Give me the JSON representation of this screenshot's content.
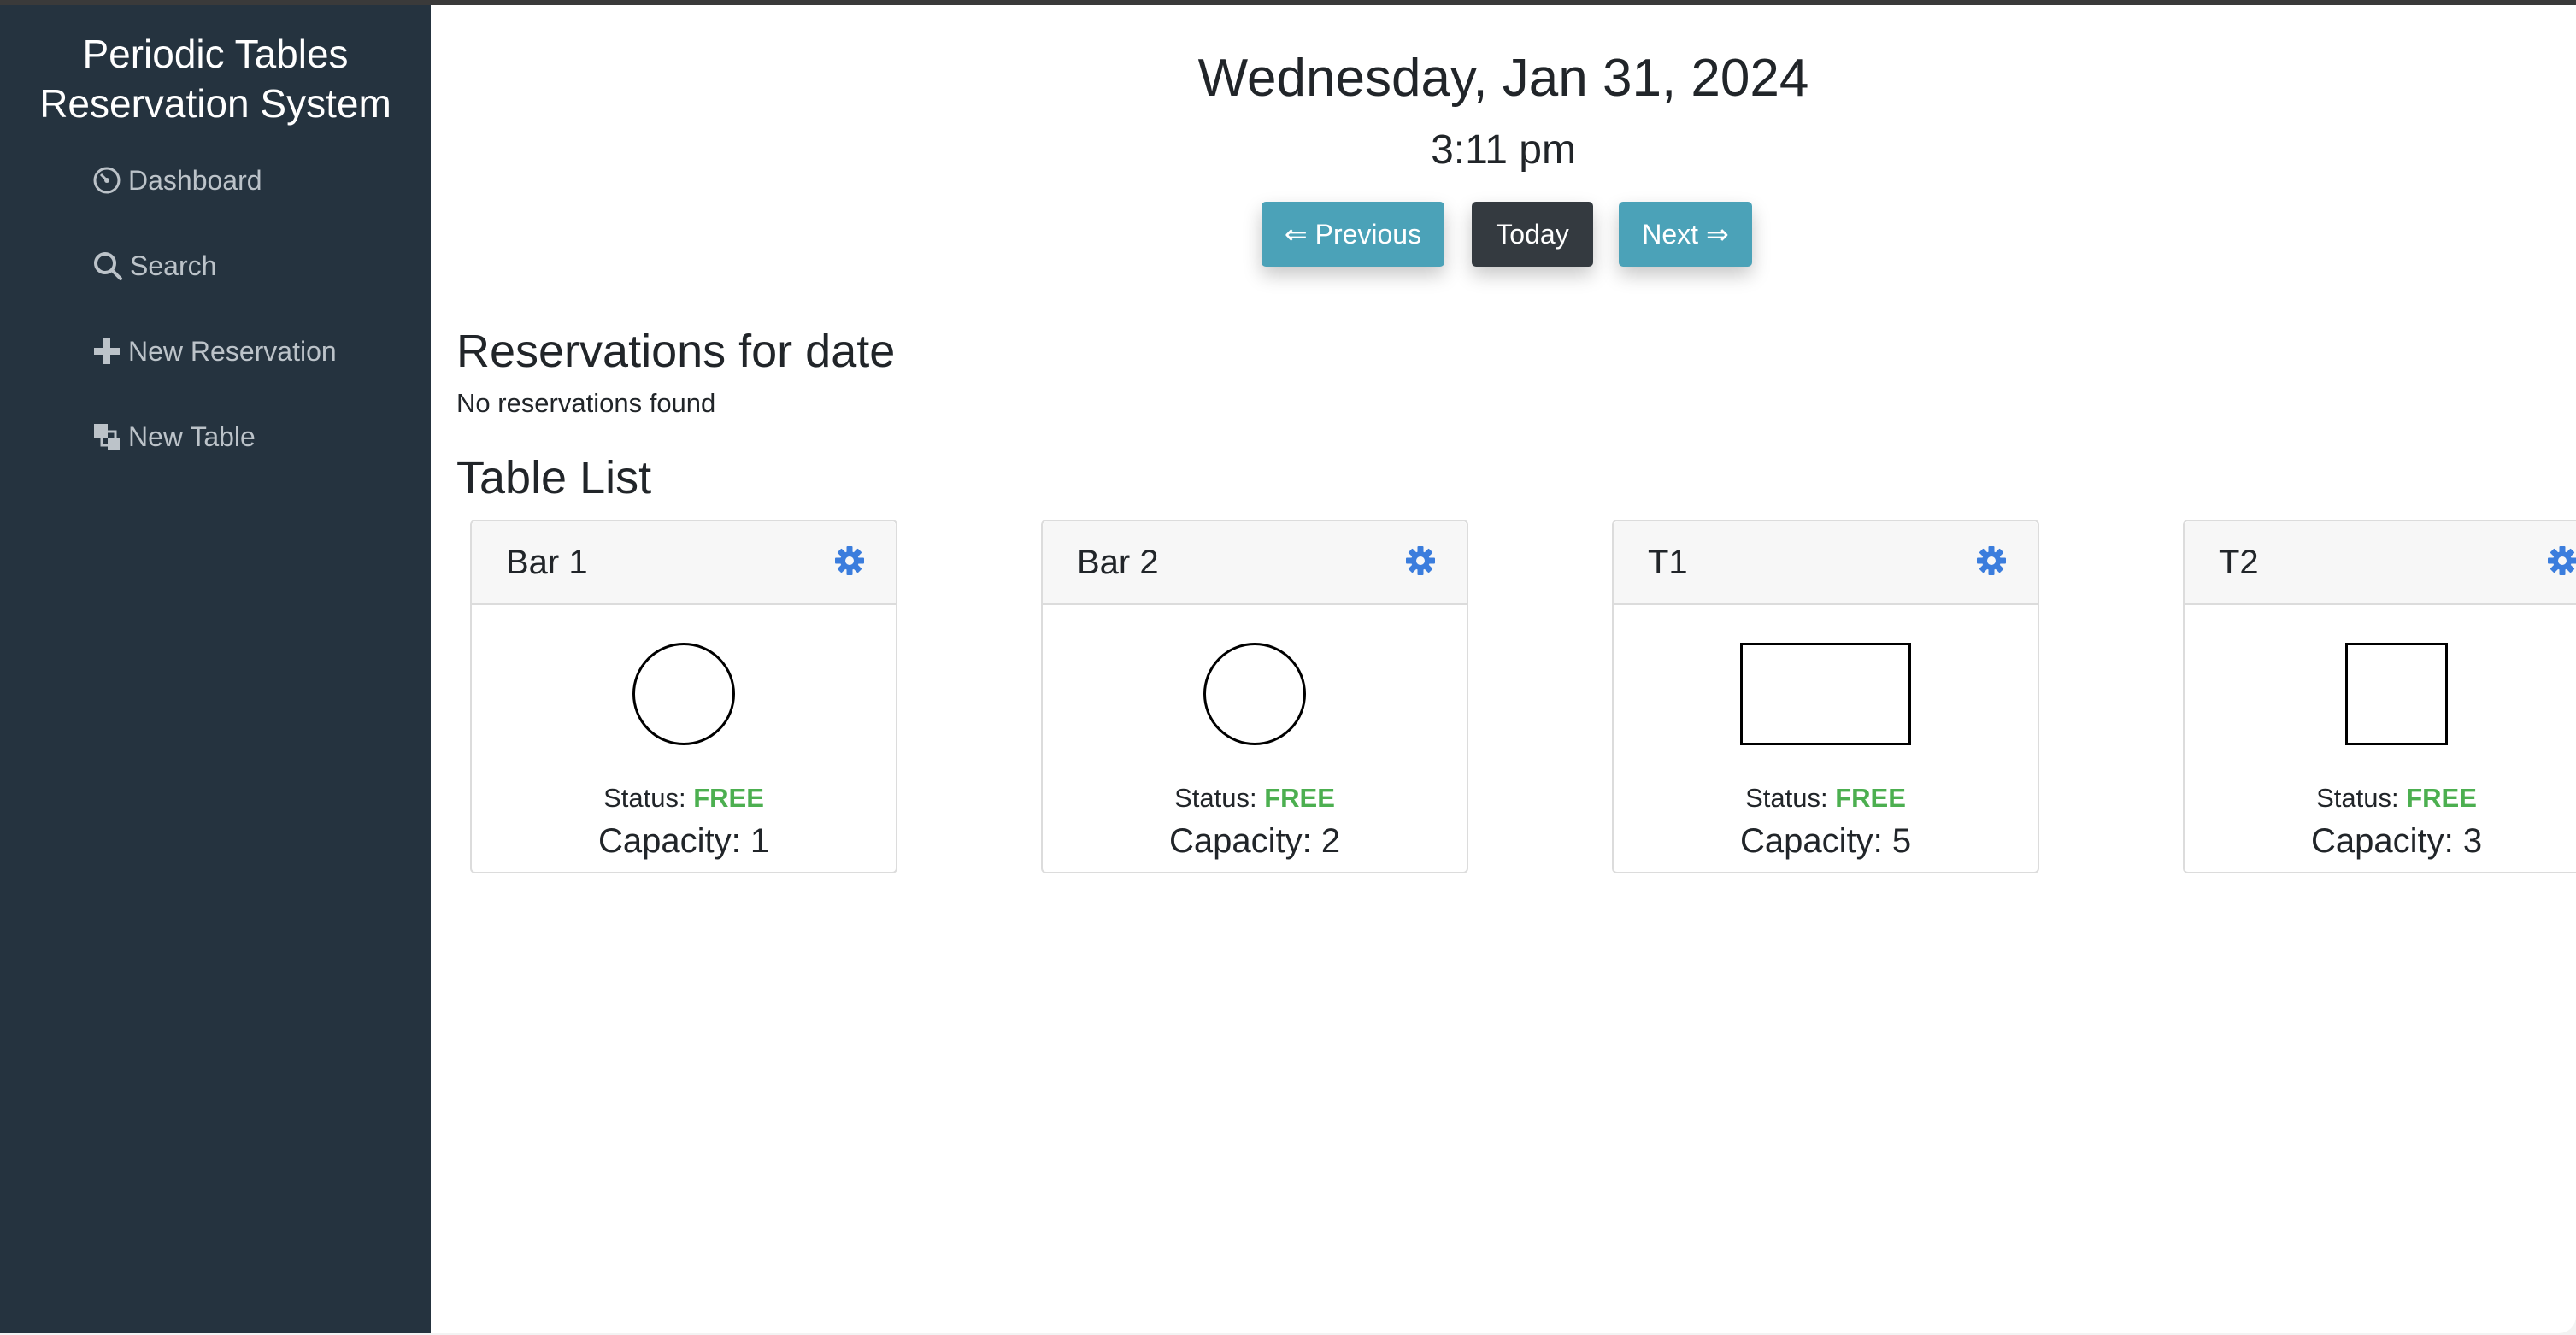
{
  "sidebar": {
    "brand_line1": "Periodic Tables",
    "brand_line2": "Reservation System",
    "items": [
      {
        "label": "Dashboard",
        "icon": "dashboard-icon"
      },
      {
        "label": "Search",
        "icon": "search-icon"
      },
      {
        "label": "New Reservation",
        "icon": "plus-icon"
      },
      {
        "label": "New Table",
        "icon": "layers-icon"
      }
    ]
  },
  "header": {
    "date": "Wednesday, Jan 31, 2024",
    "time": "3:11 pm",
    "prev_label": "⇐ Previous",
    "today_label": "Today",
    "next_label": "Next ⇒"
  },
  "reservations": {
    "title": "Reservations for date",
    "empty_text": "No reservations found"
  },
  "tables": {
    "title": "Table List",
    "status_label": "Status:",
    "capacity_label": "Capacity:",
    "items": [
      {
        "name": "Bar 1",
        "shape": "circle",
        "status": "FREE",
        "capacity": "1"
      },
      {
        "name": "Bar 2",
        "shape": "circle",
        "status": "FREE",
        "capacity": "2"
      },
      {
        "name": "T1",
        "shape": "rectangle",
        "status": "FREE",
        "capacity": "5"
      },
      {
        "name": "T2",
        "shape": "square",
        "status": "FREE",
        "capacity": "3"
      }
    ]
  },
  "colors": {
    "sidebar_bg": "#25333f",
    "info_button": "#4ba2b8",
    "dark_button": "#343a40",
    "status_free": "#4caf50",
    "gear_icon": "#3b7ddd"
  }
}
